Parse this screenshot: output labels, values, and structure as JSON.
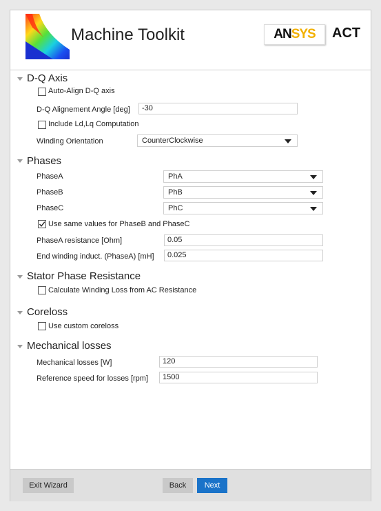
{
  "header": {
    "title": "Machine Toolkit",
    "brand_an": "AN",
    "brand_sys": "SYS",
    "act": "ACT"
  },
  "dq": {
    "title": "D-Q Axis",
    "auto_align_label": "Auto-Align D-Q axis",
    "auto_align_checked": false,
    "angle_label": "D-Q Alignement Angle [deg]",
    "angle_value": "-30",
    "ldlq_label": "Include Ld,Lq Computation",
    "ldlq_checked": false,
    "winding_label": "Winding Orientation",
    "winding_value": "CounterClockwise"
  },
  "phases": {
    "title": "Phases",
    "phaseA_label": "PhaseA",
    "phaseA_value": "PhA",
    "phaseB_label": "PhaseB",
    "phaseB_value": "PhB",
    "phaseC_label": "PhaseC",
    "phaseC_value": "PhC",
    "same_values_label": "Use same values for PhaseB and PhaseC",
    "same_values_checked": true,
    "resistance_label": "PhaseA resistance [Ohm]",
    "resistance_value": "0.05",
    "end_winding_label": "End winding induct. (PhaseA) [mH]",
    "end_winding_value": "0.025"
  },
  "stator": {
    "title": "Stator Phase Resistance",
    "calc_label": "Calculate Winding Loss from AC Resistance",
    "calc_checked": false
  },
  "coreloss": {
    "title": "Coreloss",
    "custom_label": "Use custom coreloss",
    "custom_checked": false
  },
  "mechanical": {
    "title": "Mechanical losses",
    "losses_label": "Mechanical losses [W]",
    "losses_value": "120",
    "speed_label": "Reference speed for losses [rpm]",
    "speed_value": "1500"
  },
  "footer": {
    "exit_label": "Exit Wizard",
    "back_label": "Back",
    "next_label": "Next"
  },
  "colors": {
    "accent": "#1a73c9",
    "brand_yellow": "#f2b000"
  }
}
